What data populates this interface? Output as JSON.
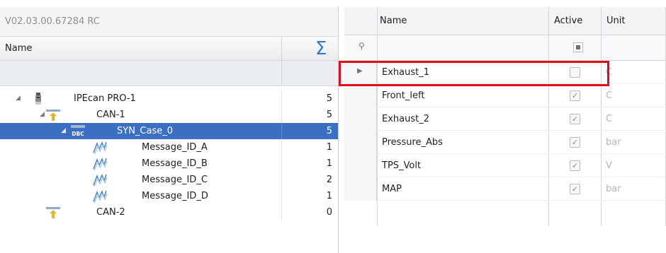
{
  "version": "V02.03.00.67284 RC",
  "tree": {
    "header_name": "Name",
    "sum_icon": "sigma-icon",
    "rows": [
      {
        "label": "IPEcan PRO-1",
        "count": "5",
        "icon": "device-icon",
        "level": 0
      },
      {
        "label": "CAN-1",
        "count": "5",
        "icon": "can-bus-icon",
        "level": 1
      },
      {
        "label": "SYN_Case_0",
        "count": "5",
        "icon": "dbc-file-icon",
        "icon_text": "DBC",
        "level": 2,
        "selected": true
      },
      {
        "label": "Message_ID_A",
        "count": "1",
        "icon": "signal-wave-icon",
        "level": 3
      },
      {
        "label": "Message_ID_B",
        "count": "1",
        "icon": "signal-wave-icon",
        "level": 3
      },
      {
        "label": "Message_ID_C",
        "count": "2",
        "icon": "signal-wave-icon",
        "level": 3
      },
      {
        "label": "Message_ID_D",
        "count": "1",
        "icon": "signal-wave-icon",
        "level": 3
      },
      {
        "label": "CAN-2",
        "count": "0",
        "icon": "can-bus-icon",
        "level": 1
      }
    ]
  },
  "grid": {
    "columns": [
      "Name",
      "Active",
      "Unit"
    ],
    "filter_icon": "filter-pin-icon",
    "active_filter_icon": "checkbox-indeterminate-icon",
    "rows": [
      {
        "name": "Exhaust_1",
        "active": false,
        "unit": "C",
        "current": true
      },
      {
        "name": "Front_left",
        "active": true,
        "unit": "C"
      },
      {
        "name": "Exhaust_2",
        "active": true,
        "unit": "C"
      },
      {
        "name": "Pressure_Abs",
        "active": true,
        "unit": "bar"
      },
      {
        "name": "TPS_Volt",
        "active": true,
        "unit": "V"
      },
      {
        "name": "MAP",
        "active": true,
        "unit": "bar"
      }
    ]
  },
  "colors": {
    "selection": "#3a6fc4",
    "highlight_border": "#e00c1a",
    "sigma": "#2b7bd6"
  }
}
